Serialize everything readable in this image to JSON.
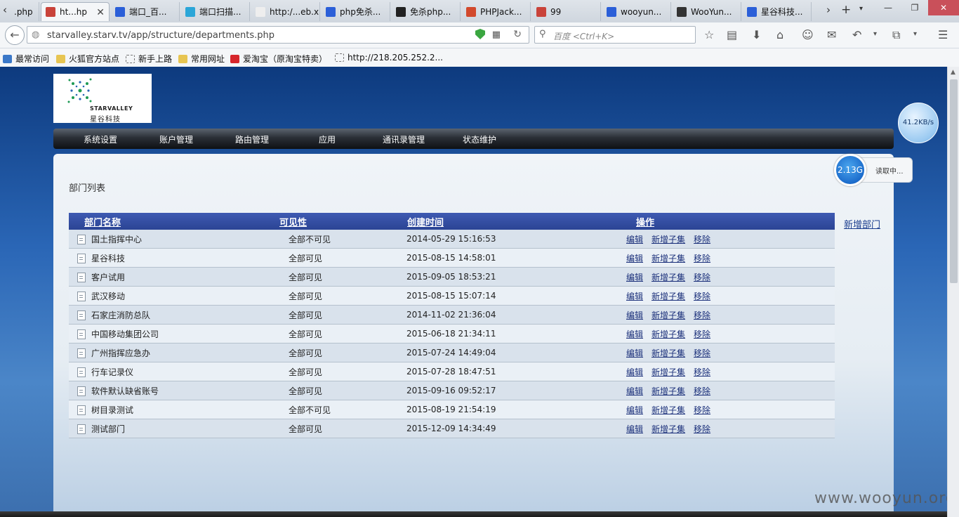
{
  "browser": {
    "tabs": [
      {
        "label": ".php",
        "icon": "page-icon"
      },
      {
        "label": "ht...hp",
        "icon": "shield-icon",
        "active": true
      },
      {
        "label": "端口_百...",
        "icon": "baidu-paw-icon"
      },
      {
        "label": "端口扫描...",
        "icon": "scanner-icon"
      },
      {
        "label": "http:/...eb.xml",
        "icon": "blank-page-icon"
      },
      {
        "label": "php免杀...",
        "icon": "baidu-paw-icon"
      },
      {
        "label": "免杀php...",
        "icon": "user-silhouette-icon"
      },
      {
        "label": "PHPJack...",
        "icon": "p-logo-icon"
      },
      {
        "label": "99",
        "icon": "shield-icon"
      },
      {
        "label": "wooyun...",
        "icon": "baidu-paw-icon"
      },
      {
        "label": "WooYun...",
        "icon": "wooyun-icon"
      },
      {
        "label": "星谷科技...",
        "icon": "baidu-paw-icon"
      }
    ],
    "url": "starvalley.starv.tv/app/structure/departments.php",
    "search_placeholder": "百度 <Ctrl+K>",
    "bookmarks": [
      {
        "label": "最常访问",
        "icon": "bookmark-star-icon"
      },
      {
        "label": "火狐官方站点",
        "icon": "folder-icon"
      },
      {
        "label": "新手上路",
        "icon": "dotted-page-icon"
      },
      {
        "label": "常用网址",
        "icon": "folder-icon"
      },
      {
        "label": "爱淘宝（原淘宝特卖）",
        "icon": "taobao-icon"
      },
      {
        "label": "http://218.205.252.2...",
        "icon": "dotted-page-icon"
      }
    ]
  },
  "app": {
    "logo": {
      "brand_en": "STARVALLEY",
      "brand_cn": "星谷科技"
    },
    "menu": [
      "系统设置",
      "账户管理",
      "路由管理",
      "应用",
      "通讯录管理",
      "状态维护"
    ],
    "section_title": "部门列表",
    "add_department": "新增部门",
    "table": {
      "columns": [
        "部门名称",
        "可见性",
        "创建时间",
        "操作"
      ],
      "rows": [
        {
          "name": "国土指挥中心",
          "visibility": "全部不可见",
          "created": "2014-05-29 15:16:53"
        },
        {
          "name": "星谷科技",
          "visibility": "全部可见",
          "created": "2015-08-15 14:58:01"
        },
        {
          "name": "客户试用",
          "visibility": "全部可见",
          "created": "2015-09-05 18:53:21"
        },
        {
          "name": "武汉移动",
          "visibility": "全部可见",
          "created": "2015-08-15 15:07:14"
        },
        {
          "name": "石家庄消防总队",
          "visibility": "全部可见",
          "created": "2014-11-02 21:36:04"
        },
        {
          "name": "中国移动集团公司",
          "visibility": "全部可见",
          "created": "2015-06-18 21:34:11"
        },
        {
          "name": "广州指挥应急办",
          "visibility": "全部可见",
          "created": "2015-07-24 14:49:04"
        },
        {
          "name": "行车记录仪",
          "visibility": "全部可见",
          "created": "2015-07-28 18:47:51"
        },
        {
          "name": "软件默认缺省账号",
          "visibility": "全部可见",
          "created": "2015-09-16 09:52:17"
        },
        {
          "name": "树目录测试",
          "visibility": "全部不可见",
          "created": "2015-08-19 21:54:19"
        },
        {
          "name": "测试部门",
          "visibility": "全部可见",
          "created": "2015-12-09 14:34:49"
        }
      ],
      "actions": [
        "编辑",
        "新增子集",
        "移除"
      ]
    }
  },
  "overlay": {
    "net_speed": "41.2KB/s",
    "disk_value": "2.13G",
    "disk_status": "读取中..."
  },
  "watermark": "www.wooyun.org",
  "colors": {
    "menu_bar": "#1a1d22",
    "table_header": "#2f4a9e",
    "page_bg": "#1f57a4",
    "link": "#1a2f7a"
  }
}
